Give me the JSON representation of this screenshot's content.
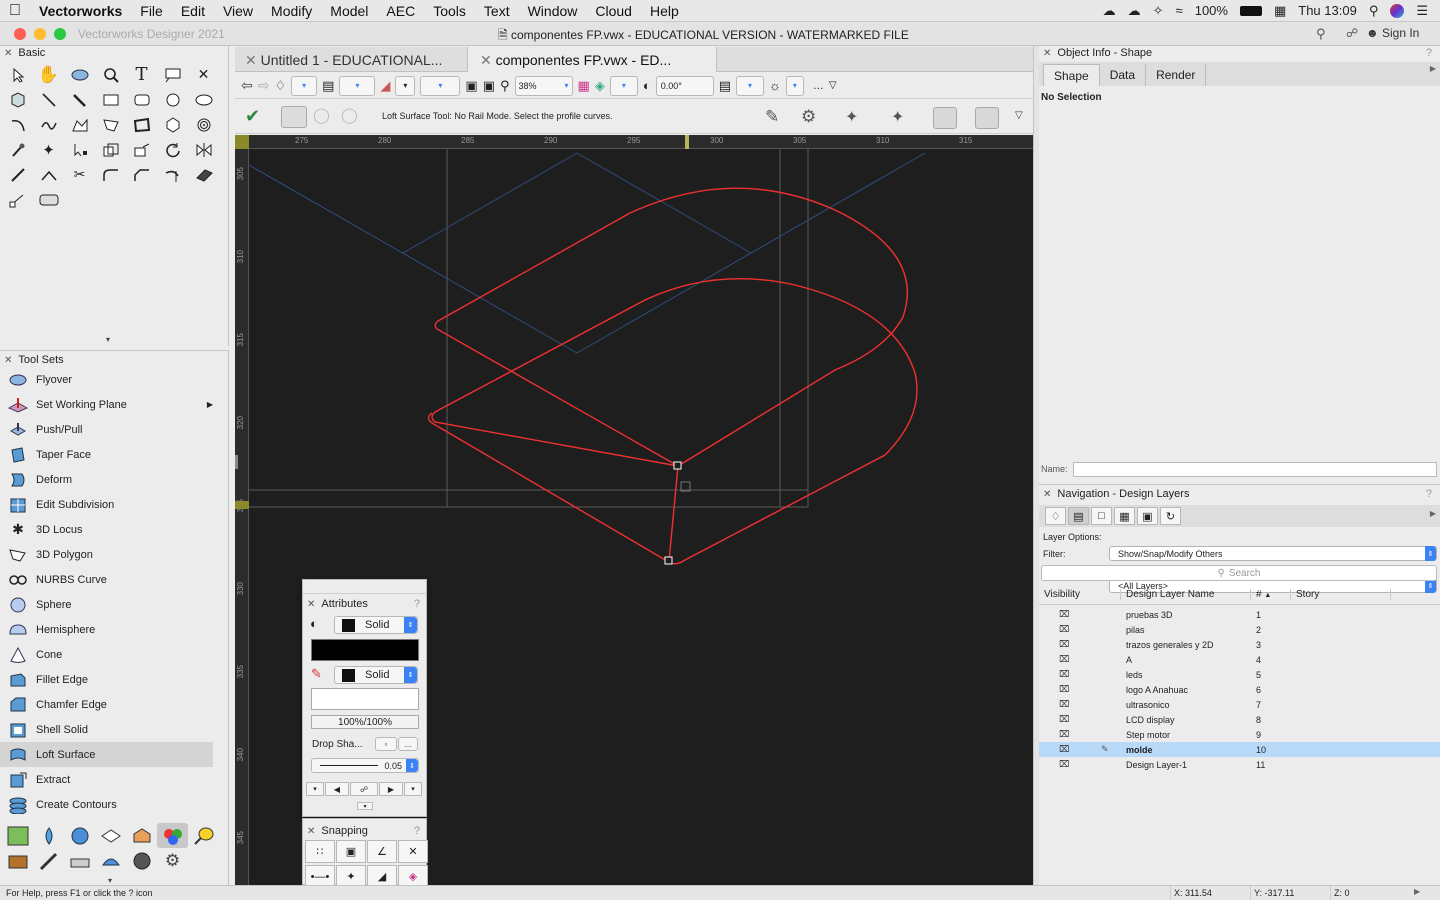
{
  "menubar": {
    "app": "Vectorworks",
    "items": [
      "File",
      "Edit",
      "View",
      "Modify",
      "Model",
      "AEC",
      "Tools",
      "Text",
      "Window",
      "Cloud",
      "Help"
    ],
    "battery": "100%",
    "clock": "Thu 13:09"
  },
  "window": {
    "app_title": "Vectorworks Designer 2021",
    "title": "componentes FP.vwx - EDUCATIONAL VERSION - WATERMARKED FILE",
    "sign_in": "Sign In"
  },
  "tabs": [
    {
      "label": "Untitled 1 - EDUCATIONAL..."
    },
    {
      "label": "componentes FP.vwx - ED..."
    }
  ],
  "view_bar": {
    "zoom": "38%",
    "rotation": "0.00°"
  },
  "mode_bar": {
    "hint": "Loft Surface Tool: No Rail Mode. Select the profile curves."
  },
  "ruler": {
    "h": [
      "275",
      "280",
      "285",
      "290",
      "295",
      "300",
      "305",
      "310",
      "315"
    ],
    "v": [
      "305",
      "310",
      "315",
      "320",
      "325",
      "330",
      "335",
      "340",
      "345"
    ]
  },
  "basic_palette": {
    "title": "Basic"
  },
  "toolsets": {
    "title": "Tool Sets",
    "items": [
      "Flyover",
      "Set Working Plane",
      "Push/Pull",
      "Taper Face",
      "Deform",
      "Edit Subdivision",
      "3D Locus",
      "3D Polygon",
      "NURBS Curve",
      "Sphere",
      "Hemisphere",
      "Cone",
      "Fillet Edge",
      "Chamfer Edge",
      "Shell Solid",
      "Loft Surface",
      "Extract",
      "Create Contours"
    ],
    "selected": "Loft Surface"
  },
  "attributes": {
    "title": "Attributes",
    "fill_style": "Solid",
    "pen_style": "Solid",
    "opacity": "100%/100%",
    "drop_shadow": "Drop Sha...",
    "line_weight": "0.05"
  },
  "snapping": {
    "title": "Snapping"
  },
  "object_info": {
    "title": "Object Info - Shape",
    "tabs": [
      "Shape",
      "Data",
      "Render"
    ],
    "status": "No Selection",
    "name_label": "Name:"
  },
  "navigation": {
    "title": "Navigation - Design Layers",
    "layer_options_label": "Layer Options:",
    "layer_options": "Show/Snap/Modify Others",
    "filter_label": "Filter:",
    "filter": "<All Layers>",
    "search_placeholder": "Search",
    "columns": [
      "Visibility",
      "Design Layer Name",
      "#",
      "Story"
    ],
    "layers": [
      {
        "name": "pruebas 3D",
        "num": "1"
      },
      {
        "name": "pilas",
        "num": "2"
      },
      {
        "name": "trazos generales y 2D",
        "num": "3"
      },
      {
        "name": "A",
        "num": "4"
      },
      {
        "name": "leds",
        "num": "5"
      },
      {
        "name": "logo A Anahuac",
        "num": "6"
      },
      {
        "name": "ultrasonico",
        "num": "7"
      },
      {
        "name": "LCD display",
        "num": "8"
      },
      {
        "name": "Step motor",
        "num": "9"
      },
      {
        "name": "molde",
        "num": "10"
      },
      {
        "name": "Design Layer-1",
        "num": "11"
      }
    ],
    "active": "molde"
  },
  "statusbar": {
    "help": "For Help, press F1 or click the ? icon",
    "x": "X: 311.54",
    "y": "Y: -317.11",
    "z": "Z: 0"
  }
}
